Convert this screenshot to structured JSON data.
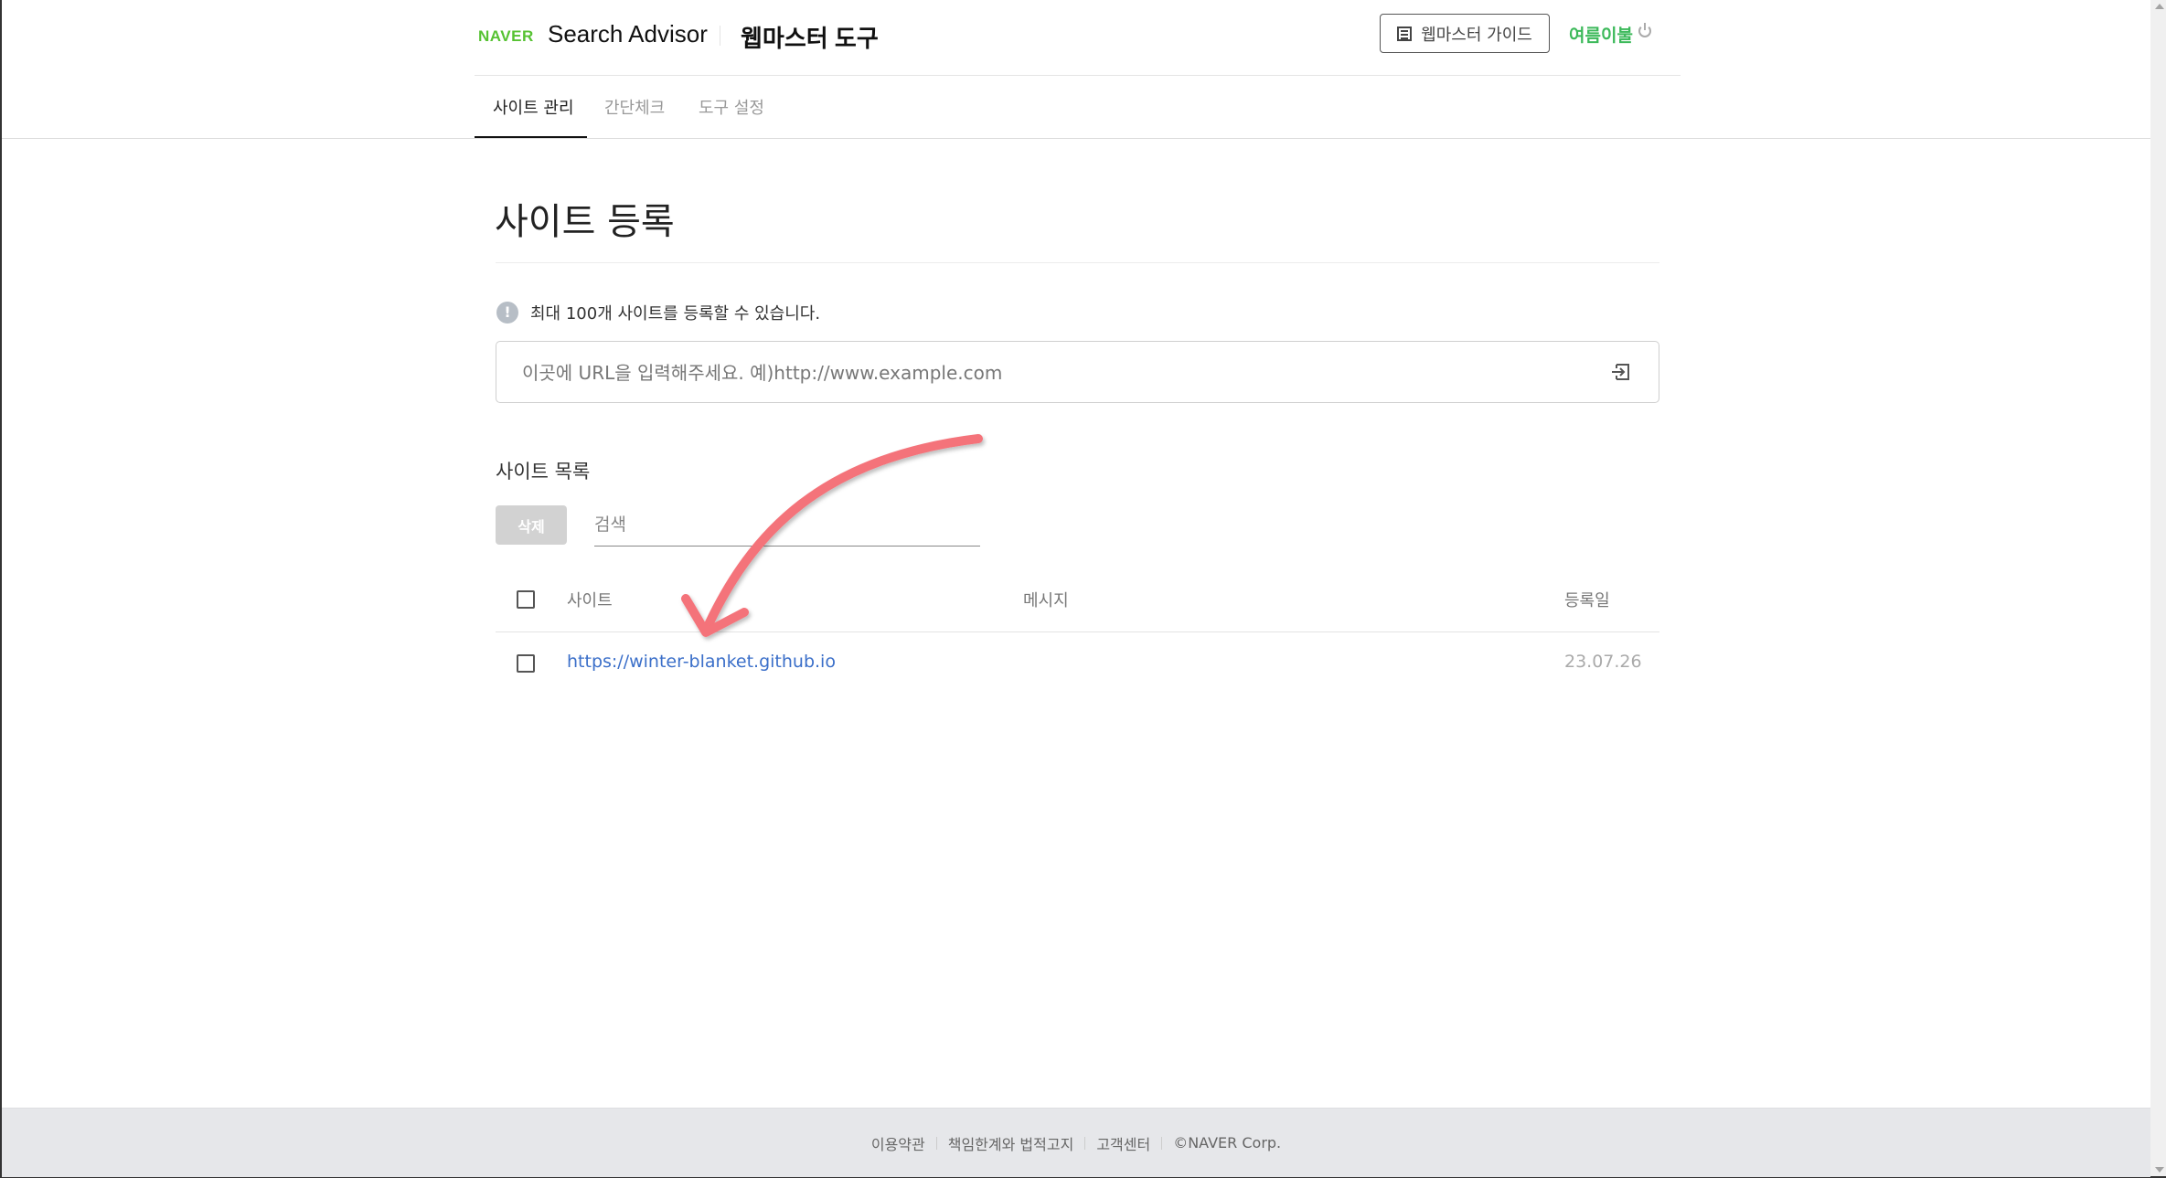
{
  "header": {
    "logo": "NAVER",
    "app_title": "Search Advisor",
    "tool_title": "웹마스터 도구",
    "guide_button": "웹마스터 가이드",
    "guide_icon": "list-book-icon",
    "user_name": "여름이불",
    "logout_icon": "power-icon",
    "brand_color": "#3cb95a"
  },
  "tabs": [
    {
      "label": "사이트 관리",
      "active": true
    },
    {
      "label": "간단체크",
      "active": false
    },
    {
      "label": "도구 설정",
      "active": false
    }
  ],
  "page": {
    "title": "사이트 등록",
    "info_text": "최대 100개 사이트를 등록할 수 있습니다.",
    "url_input": {
      "value": "",
      "placeholder": "이곳에 URL을 입력해주세요. 예)http://www.example.com"
    },
    "submit_icon": "enter-icon"
  },
  "site_list": {
    "title": "사이트 목록",
    "delete_button": "삭제",
    "search": {
      "value": "",
      "placeholder": "검색"
    },
    "columns": [
      "사이트",
      "메시지",
      "등록일"
    ],
    "rows": [
      {
        "site": "https://winter-blanket.github.io",
        "message": "",
        "date": "23.07.26",
        "checked": false
      }
    ]
  },
  "annotation": {
    "type": "curved-arrow",
    "color": "#f4737a",
    "points_to": "https://winter-blanket.github.io"
  },
  "footer": {
    "links": [
      "이용약관",
      "책임한계와 법적고지",
      "고객센터"
    ],
    "copyright": "©NAVER Corp."
  }
}
